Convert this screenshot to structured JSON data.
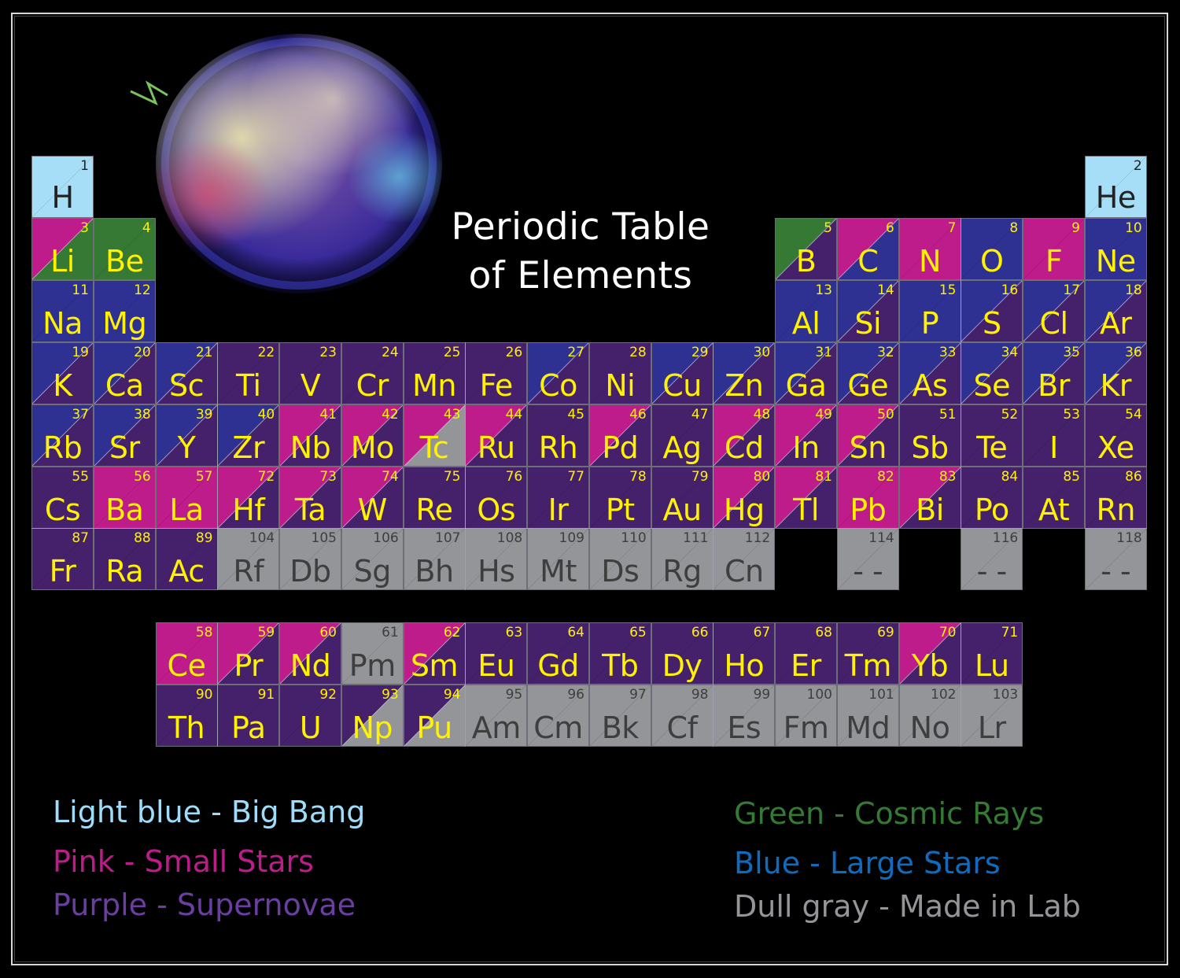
{
  "title": {
    "line1": "Periodic Table",
    "line2": "of Elements"
  },
  "colors": {
    "bigbang": "#a6def7",
    "small": "#be1b8b",
    "super": "#44216a",
    "cosmic": "#367934",
    "large": "#2e3192",
    "lab": "#939598",
    "text_yellow": "#fff200"
  },
  "legend": [
    {
      "label": "Light blue - Big Bang",
      "color": "#9fdcf8",
      "side": "left"
    },
    {
      "label": "Pink - Small Stars",
      "color": "#be1b8b",
      "side": "left"
    },
    {
      "label": "Purple - Supernovae",
      "color": "#6a3fa0",
      "side": "left"
    },
    {
      "label": "Green - Cosmic Rays",
      "color": "#367934",
      "side": "right"
    },
    {
      "label": "Blue - Large Stars",
      "color": "#0e6cc0",
      "side": "right"
    },
    {
      "label": "Dull gray - Made in Lab",
      "color": "#939598",
      "side": "right"
    }
  ],
  "elements": [
    {
      "n": "1",
      "s": "H",
      "r": 1,
      "c": 1,
      "tl": "bigbang",
      "br": "bigbang",
      "t": "dark"
    },
    {
      "n": "2",
      "s": "He",
      "r": 1,
      "c": 18,
      "tl": "bigbang",
      "br": "bigbang",
      "t": "dark"
    },
    {
      "n": "3",
      "s": "Li",
      "r": 2,
      "c": 1,
      "tl": "small",
      "br": "cosmic",
      "t": "yellow"
    },
    {
      "n": "4",
      "s": "Be",
      "r": 2,
      "c": 2,
      "tl": "cosmic",
      "br": "cosmic",
      "t": "yellow"
    },
    {
      "n": "5",
      "s": "B",
      "r": 2,
      "c": 13,
      "tl": "cosmic",
      "br": "super",
      "t": "yellow"
    },
    {
      "n": "6",
      "s": "C",
      "r": 2,
      "c": 14,
      "tl": "small",
      "br": "large",
      "t": "yellow"
    },
    {
      "n": "7",
      "s": "N",
      "r": 2,
      "c": 15,
      "tl": "small",
      "br": "small",
      "t": "yellow"
    },
    {
      "n": "8",
      "s": "O",
      "r": 2,
      "c": 16,
      "tl": "large",
      "br": "large",
      "t": "yellow"
    },
    {
      "n": "9",
      "s": "F",
      "r": 2,
      "c": 17,
      "tl": "small",
      "br": "small",
      "t": "yellow"
    },
    {
      "n": "10",
      "s": "Ne",
      "r": 2,
      "c": 18,
      "tl": "large",
      "br": "large",
      "t": "yellow"
    },
    {
      "n": "11",
      "s": "Na",
      "r": 3,
      "c": 1,
      "tl": "large",
      "br": "large",
      "t": "yellow"
    },
    {
      "n": "12",
      "s": "Mg",
      "r": 3,
      "c": 2,
      "tl": "large",
      "br": "large",
      "t": "yellow"
    },
    {
      "n": "13",
      "s": "Al",
      "r": 3,
      "c": 13,
      "tl": "large",
      "br": "large",
      "t": "yellow"
    },
    {
      "n": "14",
      "s": "Si",
      "r": 3,
      "c": 14,
      "tl": "large",
      "br": "super",
      "t": "yellow"
    },
    {
      "n": "15",
      "s": "P",
      "r": 3,
      "c": 15,
      "tl": "large",
      "br": "large",
      "t": "yellow"
    },
    {
      "n": "16",
      "s": "S",
      "r": 3,
      "c": 16,
      "tl": "large",
      "br": "super",
      "t": "yellow"
    },
    {
      "n": "17",
      "s": "Cl",
      "r": 3,
      "c": 17,
      "tl": "large",
      "br": "super",
      "t": "yellow"
    },
    {
      "n": "18",
      "s": "Ar",
      "r": 3,
      "c": 18,
      "tl": "large",
      "br": "super",
      "t": "yellow"
    },
    {
      "n": "19",
      "s": "K",
      "r": 4,
      "c": 1,
      "tl": "large",
      "br": "super",
      "t": "yellow"
    },
    {
      "n": "20",
      "s": "Ca",
      "r": 4,
      "c": 2,
      "tl": "large",
      "br": "super",
      "t": "yellow"
    },
    {
      "n": "21",
      "s": "Sc",
      "r": 4,
      "c": 3,
      "tl": "large",
      "br": "super",
      "t": "yellow"
    },
    {
      "n": "22",
      "s": "Ti",
      "r": 4,
      "c": 4,
      "tl": "super",
      "br": "super",
      "t": "yellow"
    },
    {
      "n": "23",
      "s": "V",
      "r": 4,
      "c": 5,
      "tl": "super",
      "br": "super",
      "t": "yellow"
    },
    {
      "n": "24",
      "s": "Cr",
      "r": 4,
      "c": 6,
      "tl": "super",
      "br": "super",
      "t": "yellow"
    },
    {
      "n": "25",
      "s": "Mn",
      "r": 4,
      "c": 7,
      "tl": "super",
      "br": "super",
      "t": "yellow"
    },
    {
      "n": "26",
      "s": "Fe",
      "r": 4,
      "c": 8,
      "tl": "super",
      "br": "super",
      "t": "yellow"
    },
    {
      "n": "27",
      "s": "Co",
      "r": 4,
      "c": 9,
      "tl": "large",
      "br": "super",
      "t": "yellow"
    },
    {
      "n": "28",
      "s": "Ni",
      "r": 4,
      "c": 10,
      "tl": "super",
      "br": "super",
      "t": "yellow"
    },
    {
      "n": "29",
      "s": "Cu",
      "r": 4,
      "c": 11,
      "tl": "large",
      "br": "super",
      "t": "yellow"
    },
    {
      "n": "30",
      "s": "Zn",
      "r": 4,
      "c": 12,
      "tl": "large",
      "br": "super",
      "t": "yellow"
    },
    {
      "n": "31",
      "s": "Ga",
      "r": 4,
      "c": 13,
      "tl": "large",
      "br": "super",
      "t": "yellow"
    },
    {
      "n": "32",
      "s": "Ge",
      "r": 4,
      "c": 14,
      "tl": "large",
      "br": "super",
      "t": "yellow"
    },
    {
      "n": "33",
      "s": "As",
      "r": 4,
      "c": 15,
      "tl": "large",
      "br": "super",
      "t": "yellow"
    },
    {
      "n": "34",
      "s": "Se",
      "r": 4,
      "c": 16,
      "tl": "large",
      "br": "super",
      "t": "yellow"
    },
    {
      "n": "35",
      "s": "Br",
      "r": 4,
      "c": 17,
      "tl": "large",
      "br": "super",
      "t": "yellow"
    },
    {
      "n": "36",
      "s": "Kr",
      "r": 4,
      "c": 18,
      "tl": "large",
      "br": "super",
      "t": "yellow"
    },
    {
      "n": "37",
      "s": "Rb",
      "r": 5,
      "c": 1,
      "tl": "large",
      "br": "super",
      "t": "yellow"
    },
    {
      "n": "38",
      "s": "Sr",
      "r": 5,
      "c": 2,
      "tl": "large",
      "br": "super",
      "t": "yellow"
    },
    {
      "n": "39",
      "s": "Y",
      "r": 5,
      "c": 3,
      "tl": "large",
      "br": "super",
      "t": "yellow"
    },
    {
      "n": "40",
      "s": "Zr",
      "r": 5,
      "c": 4,
      "tl": "large",
      "br": "super",
      "t": "yellow"
    },
    {
      "n": "41",
      "s": "Nb",
      "r": 5,
      "c": 5,
      "tl": "small",
      "br": "super",
      "t": "yellow"
    },
    {
      "n": "42",
      "s": "Mo",
      "r": 5,
      "c": 6,
      "tl": "small",
      "br": "super",
      "t": "yellow"
    },
    {
      "n": "43",
      "s": "Tc",
      "r": 5,
      "c": 7,
      "tl": "small",
      "br": "lab",
      "t": "yellow"
    },
    {
      "n": "44",
      "s": "Ru",
      "r": 5,
      "c": 8,
      "tl": "small",
      "br": "super",
      "t": "yellow"
    },
    {
      "n": "45",
      "s": "Rh",
      "r": 5,
      "c": 9,
      "tl": "super",
      "br": "super",
      "t": "yellow"
    },
    {
      "n": "46",
      "s": "Pd",
      "r": 5,
      "c": 10,
      "tl": "small",
      "br": "super",
      "t": "yellow"
    },
    {
      "n": "47",
      "s": "Ag",
      "r": 5,
      "c": 11,
      "tl": "super",
      "br": "super",
      "t": "yellow"
    },
    {
      "n": "48",
      "s": "Cd",
      "r": 5,
      "c": 12,
      "tl": "small",
      "br": "super",
      "t": "yellow"
    },
    {
      "n": "49",
      "s": "In",
      "r": 5,
      "c": 13,
      "tl": "small",
      "br": "super",
      "t": "yellow"
    },
    {
      "n": "50",
      "s": "Sn",
      "r": 5,
      "c": 14,
      "tl": "small",
      "br": "super",
      "t": "yellow"
    },
    {
      "n": "51",
      "s": "Sb",
      "r": 5,
      "c": 15,
      "tl": "super",
      "br": "super",
      "t": "yellow"
    },
    {
      "n": "52",
      "s": "Te",
      "r": 5,
      "c": 16,
      "tl": "super",
      "br": "super",
      "t": "yellow"
    },
    {
      "n": "53",
      "s": "I",
      "r": 5,
      "c": 17,
      "tl": "super",
      "br": "super",
      "t": "yellow"
    },
    {
      "n": "54",
      "s": "Xe",
      "r": 5,
      "c": 18,
      "tl": "super",
      "br": "super",
      "t": "yellow"
    },
    {
      "n": "55",
      "s": "Cs",
      "r": 6,
      "c": 1,
      "tl": "super",
      "br": "super",
      "t": "yellow"
    },
    {
      "n": "56",
      "s": "Ba",
      "r": 6,
      "c": 2,
      "tl": "small",
      "br": "small",
      "t": "yellow"
    },
    {
      "n": "57",
      "s": "La",
      "r": 6,
      "c": 3,
      "tl": "small",
      "br": "small",
      "t": "yellow"
    },
    {
      "n": "72",
      "s": "Hf",
      "r": 6,
      "c": 4,
      "tl": "small",
      "br": "super",
      "t": "yellow"
    },
    {
      "n": "73",
      "s": "Ta",
      "r": 6,
      "c": 5,
      "tl": "small",
      "br": "super",
      "t": "yellow"
    },
    {
      "n": "74",
      "s": "W",
      "r": 6,
      "c": 6,
      "tl": "small",
      "br": "super",
      "t": "yellow"
    },
    {
      "n": "75",
      "s": "Re",
      "r": 6,
      "c": 7,
      "tl": "super",
      "br": "super",
      "t": "yellow"
    },
    {
      "n": "76",
      "s": "Os",
      "r": 6,
      "c": 8,
      "tl": "super",
      "br": "super",
      "t": "yellow"
    },
    {
      "n": "77",
      "s": "Ir",
      "r": 6,
      "c": 9,
      "tl": "super",
      "br": "super",
      "t": "yellow"
    },
    {
      "n": "78",
      "s": "Pt",
      "r": 6,
      "c": 10,
      "tl": "super",
      "br": "super",
      "t": "yellow"
    },
    {
      "n": "79",
      "s": "Au",
      "r": 6,
      "c": 11,
      "tl": "super",
      "br": "super",
      "t": "yellow"
    },
    {
      "n": "80",
      "s": "Hg",
      "r": 6,
      "c": 12,
      "tl": "small",
      "br": "super",
      "t": "yellow"
    },
    {
      "n": "81",
      "s": "Tl",
      "r": 6,
      "c": 13,
      "tl": "small",
      "br": "super",
      "t": "yellow"
    },
    {
      "n": "82",
      "s": "Pb",
      "r": 6,
      "c": 14,
      "tl": "small",
      "br": "small",
      "t": "yellow"
    },
    {
      "n": "83",
      "s": "Bi",
      "r": 6,
      "c": 15,
      "tl": "small",
      "br": "super",
      "t": "yellow"
    },
    {
      "n": "84",
      "s": "Po",
      "r": 6,
      "c": 16,
      "tl": "super",
      "br": "super",
      "t": "yellow"
    },
    {
      "n": "85",
      "s": "At",
      "r": 6,
      "c": 17,
      "tl": "super",
      "br": "super",
      "t": "yellow"
    },
    {
      "n": "86",
      "s": "Rn",
      "r": 6,
      "c": 18,
      "tl": "super",
      "br": "super",
      "t": "yellow"
    },
    {
      "n": "87",
      "s": "Fr",
      "r": 7,
      "c": 1,
      "tl": "super",
      "br": "super",
      "t": "yellow"
    },
    {
      "n": "88",
      "s": "Ra",
      "r": 7,
      "c": 2,
      "tl": "super",
      "br": "super",
      "t": "yellow"
    },
    {
      "n": "89",
      "s": "Ac",
      "r": 7,
      "c": 3,
      "tl": "super",
      "br": "super",
      "t": "yellow"
    },
    {
      "n": "104",
      "s": "Rf",
      "r": 7,
      "c": 4,
      "tl": "lab",
      "br": "lab",
      "t": "gray"
    },
    {
      "n": "105",
      "s": "Db",
      "r": 7,
      "c": 5,
      "tl": "lab",
      "br": "lab",
      "t": "gray"
    },
    {
      "n": "106",
      "s": "Sg",
      "r": 7,
      "c": 6,
      "tl": "lab",
      "br": "lab",
      "t": "gray"
    },
    {
      "n": "107",
      "s": "Bh",
      "r": 7,
      "c": 7,
      "tl": "lab",
      "br": "lab",
      "t": "gray"
    },
    {
      "n": "108",
      "s": "Hs",
      "r": 7,
      "c": 8,
      "tl": "lab",
      "br": "lab",
      "t": "gray"
    },
    {
      "n": "109",
      "s": "Mt",
      "r": 7,
      "c": 9,
      "tl": "lab",
      "br": "lab",
      "t": "gray"
    },
    {
      "n": "110",
      "s": "Ds",
      "r": 7,
      "c": 10,
      "tl": "lab",
      "br": "lab",
      "t": "gray"
    },
    {
      "n": "111",
      "s": "Rg",
      "r": 7,
      "c": 11,
      "tl": "lab",
      "br": "lab",
      "t": "gray"
    },
    {
      "n": "112",
      "s": "Cn",
      "r": 7,
      "c": 12,
      "tl": "lab",
      "br": "lab",
      "t": "gray"
    },
    {
      "n": "114",
      "s": "- -",
      "r": 7,
      "c": 14,
      "tl": "lab",
      "br": "lab",
      "t": "gray"
    },
    {
      "n": "116",
      "s": "- -",
      "r": 7,
      "c": 16,
      "tl": "lab",
      "br": "lab",
      "t": "gray"
    },
    {
      "n": "118",
      "s": "- -",
      "r": 7,
      "c": 18,
      "tl": "lab",
      "br": "lab",
      "t": "gray"
    },
    {
      "n": "58",
      "s": "Ce",
      "r": 9,
      "c": 3,
      "tl": "small",
      "br": "small",
      "t": "yellow"
    },
    {
      "n": "59",
      "s": "Pr",
      "r": 9,
      "c": 4,
      "tl": "small",
      "br": "super",
      "t": "yellow"
    },
    {
      "n": "60",
      "s": "Nd",
      "r": 9,
      "c": 5,
      "tl": "small",
      "br": "super",
      "t": "yellow"
    },
    {
      "n": "61",
      "s": "Pm",
      "r": 9,
      "c": 6,
      "tl": "lab",
      "br": "lab",
      "t": "gray"
    },
    {
      "n": "62",
      "s": "Sm",
      "r": 9,
      "c": 7,
      "tl": "small",
      "br": "super",
      "t": "yellow"
    },
    {
      "n": "63",
      "s": "Eu",
      "r": 9,
      "c": 8,
      "tl": "super",
      "br": "super",
      "t": "yellow"
    },
    {
      "n": "64",
      "s": "Gd",
      "r": 9,
      "c": 9,
      "tl": "super",
      "br": "super",
      "t": "yellow"
    },
    {
      "n": "65",
      "s": "Tb",
      "r": 9,
      "c": 10,
      "tl": "super",
      "br": "super",
      "t": "yellow"
    },
    {
      "n": "66",
      "s": "Dy",
      "r": 9,
      "c": 11,
      "tl": "super",
      "br": "super",
      "t": "yellow"
    },
    {
      "n": "67",
      "s": "Ho",
      "r": 9,
      "c": 12,
      "tl": "super",
      "br": "super",
      "t": "yellow"
    },
    {
      "n": "68",
      "s": "Er",
      "r": 9,
      "c": 13,
      "tl": "super",
      "br": "super",
      "t": "yellow"
    },
    {
      "n": "69",
      "s": "Tm",
      "r": 9,
      "c": 14,
      "tl": "super",
      "br": "super",
      "t": "yellow"
    },
    {
      "n": "70",
      "s": "Yb",
      "r": 9,
      "c": 15,
      "tl": "small",
      "br": "super",
      "t": "yellow"
    },
    {
      "n": "71",
      "s": "Lu",
      "r": 9,
      "c": 16,
      "tl": "super",
      "br": "super",
      "t": "yellow"
    },
    {
      "n": "90",
      "s": "Th",
      "r": 10,
      "c": 3,
      "tl": "super",
      "br": "super",
      "t": "yellow"
    },
    {
      "n": "91",
      "s": "Pa",
      "r": 10,
      "c": 4,
      "tl": "super",
      "br": "super",
      "t": "yellow"
    },
    {
      "n": "92",
      "s": "U",
      "r": 10,
      "c": 5,
      "tl": "super",
      "br": "super",
      "t": "yellow"
    },
    {
      "n": "93",
      "s": "Np",
      "r": 10,
      "c": 6,
      "tl": "super",
      "br": "lab",
      "t": "yellow"
    },
    {
      "n": "94",
      "s": "Pu",
      "r": 10,
      "c": 7,
      "tl": "super",
      "br": "lab",
      "t": "yellow"
    },
    {
      "n": "95",
      "s": "Am",
      "r": 10,
      "c": 8,
      "tl": "lab",
      "br": "lab",
      "t": "gray"
    },
    {
      "n": "96",
      "s": "Cm",
      "r": 10,
      "c": 9,
      "tl": "lab",
      "br": "lab",
      "t": "gray"
    },
    {
      "n": "97",
      "s": "Bk",
      "r": 10,
      "c": 10,
      "tl": "lab",
      "br": "lab",
      "t": "gray"
    },
    {
      "n": "98",
      "s": "Cf",
      "r": 10,
      "c": 11,
      "tl": "lab",
      "br": "lab",
      "t": "gray"
    },
    {
      "n": "99",
      "s": "Es",
      "r": 10,
      "c": 12,
      "tl": "lab",
      "br": "lab",
      "t": "gray"
    },
    {
      "n": "100",
      "s": "Fm",
      "r": 10,
      "c": 13,
      "tl": "lab",
      "br": "lab",
      "t": "gray"
    },
    {
      "n": "101",
      "s": "Md",
      "r": 10,
      "c": 14,
      "tl": "lab",
      "br": "lab",
      "t": "gray"
    },
    {
      "n": "102",
      "s": "No",
      "r": 10,
      "c": 15,
      "tl": "lab",
      "br": "lab",
      "t": "gray"
    },
    {
      "n": "103",
      "s": "Lr",
      "r": 10,
      "c": 16,
      "tl": "lab",
      "br": "lab",
      "t": "gray"
    }
  ]
}
